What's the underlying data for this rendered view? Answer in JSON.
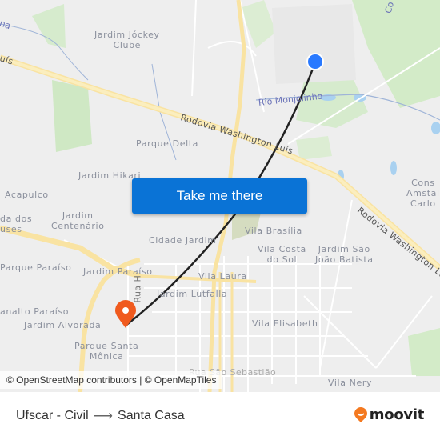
{
  "map": {
    "neighborhoods": [
      {
        "name": "Jardim Jóckey\nClube"
      },
      {
        "name": "Parque Delta"
      },
      {
        "name": "Jardim Hikari"
      },
      {
        "name": "Acapulco"
      },
      {
        "name": "da dos\nuses"
      },
      {
        "name": "Jardim\nCentenário"
      },
      {
        "name": "Cidade Jardim"
      },
      {
        "name": "Parque Paraíso"
      },
      {
        "name": "Jardim Paraíso"
      },
      {
        "name": "analto Paraíso"
      },
      {
        "name": "Jardim Alvorada"
      },
      {
        "name": "Parque Santa\nMônica"
      },
      {
        "name": "Jardim Lutfalla"
      },
      {
        "name": "Vila Laura"
      },
      {
        "name": "Vila Brasília"
      },
      {
        "name": "Vila Costa\ndo Sol"
      },
      {
        "name": "Jardim São\nJoão Batista"
      },
      {
        "name": "Vila Elisabeth"
      },
      {
        "name": "Vila Nery"
      },
      {
        "name": "Cons\nAmstal\nCarlo"
      }
    ],
    "roads": {
      "highway_west": "uís",
      "highway_center": "Rodovia Washington Luís",
      "highway_east": "Rodovia Washington Luís",
      "street_h": "Rua H",
      "street_sebastiao": "Rua São Sebastião",
      "top_left_road": "na",
      "top_right_road": "Co"
    },
    "river": "Rio Monjolinho",
    "origin_marker": {
      "type": "blue-dot",
      "color": "#2979ff"
    },
    "destination_marker": {
      "type": "pin",
      "color": "#f05a1e"
    },
    "route_line_color": "#222222"
  },
  "cta": {
    "label": "Take me there",
    "color": "#0a73d6"
  },
  "attribution": "© OpenStreetMap contributors | © OpenMapTiles",
  "footer": {
    "origin": "Ufscar - Civil",
    "arrow": "⟶",
    "destination": "Santa Casa",
    "brand": "moovit",
    "brand_color": "#f47920"
  }
}
